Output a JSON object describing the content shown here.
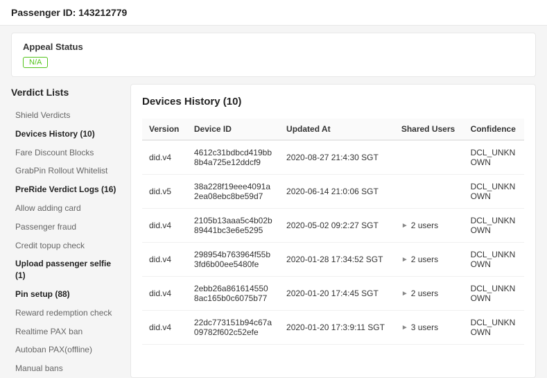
{
  "header": {
    "passenger_id_label": "Passenger ID: 143212779"
  },
  "appeal": {
    "label": "Appeal Status",
    "badge": "N/A"
  },
  "sidebar": {
    "section_title": "Verdict Lists",
    "items": [
      {
        "label": "Shield Verdicts",
        "active": false
      },
      {
        "label": "Devices History (10)",
        "active": true
      },
      {
        "label": "Fare Discount Blocks",
        "active": false
      },
      {
        "label": "GrabPin Rollout Whitelist",
        "active": false
      },
      {
        "label": "PreRide Verdict Logs (16)",
        "active": true
      },
      {
        "label": "Allow adding card",
        "active": false
      },
      {
        "label": "Passenger fraud",
        "active": false
      },
      {
        "label": "Credit topup check",
        "active": false
      },
      {
        "label": "Upload passenger selfie (1)",
        "active": true
      },
      {
        "label": "Pin setup (88)",
        "active": true
      },
      {
        "label": "Reward redemption check",
        "active": false
      },
      {
        "label": "Realtime PAX ban",
        "active": false
      },
      {
        "label": "Autoban PAX(offline)",
        "active": false
      },
      {
        "label": "Manual bans",
        "active": false
      }
    ]
  },
  "content": {
    "title": "Devices History (10)",
    "table": {
      "columns": [
        "Version",
        "Device ID",
        "Updated At",
        "Shared Users",
        "Confidence"
      ],
      "rows": [
        {
          "version": "did.v4",
          "device_id": "4612c31bdbcd419bb8b4a725e12ddcf9",
          "updated_at": "2020-08-27 21:4:30 SGT",
          "shared_users": "",
          "confidence": "DCL_UNKNOWN"
        },
        {
          "version": "did.v5",
          "device_id": "38a228f19eee4091a2ea08ebc8be59d7",
          "updated_at": "2020-06-14 21:0:06 SGT",
          "shared_users": "",
          "confidence": "DCL_UNKNOWN"
        },
        {
          "version": "did.v4",
          "device_id": "2105b13aaa5c4b02b89441bc3e6e5295",
          "updated_at": "2020-05-02 09:2:27 SGT",
          "shared_users": "2 users",
          "confidence": "DCL_UNKNOWN"
        },
        {
          "version": "did.v4",
          "device_id": "298954b763964f55b3fd6b00ee5480fe",
          "updated_at": "2020-01-28 17:34:52 SGT",
          "shared_users": "2 users",
          "confidence": "DCL_UNKNOWN"
        },
        {
          "version": "did.v4",
          "device_id": "2ebb26a8616145508ac165b0c6075b77",
          "updated_at": "2020-01-20 17:4:45 SGT",
          "shared_users": "2 users",
          "confidence": "DCL_UNKNOWN"
        },
        {
          "version": "did.v4",
          "device_id": "22dc773151b94c67a09782f602c52efe",
          "updated_at": "2020-01-20 17:3:9:11 SGT",
          "shared_users": "3 users",
          "confidence": "DCL_UNKNOWN"
        }
      ]
    }
  }
}
